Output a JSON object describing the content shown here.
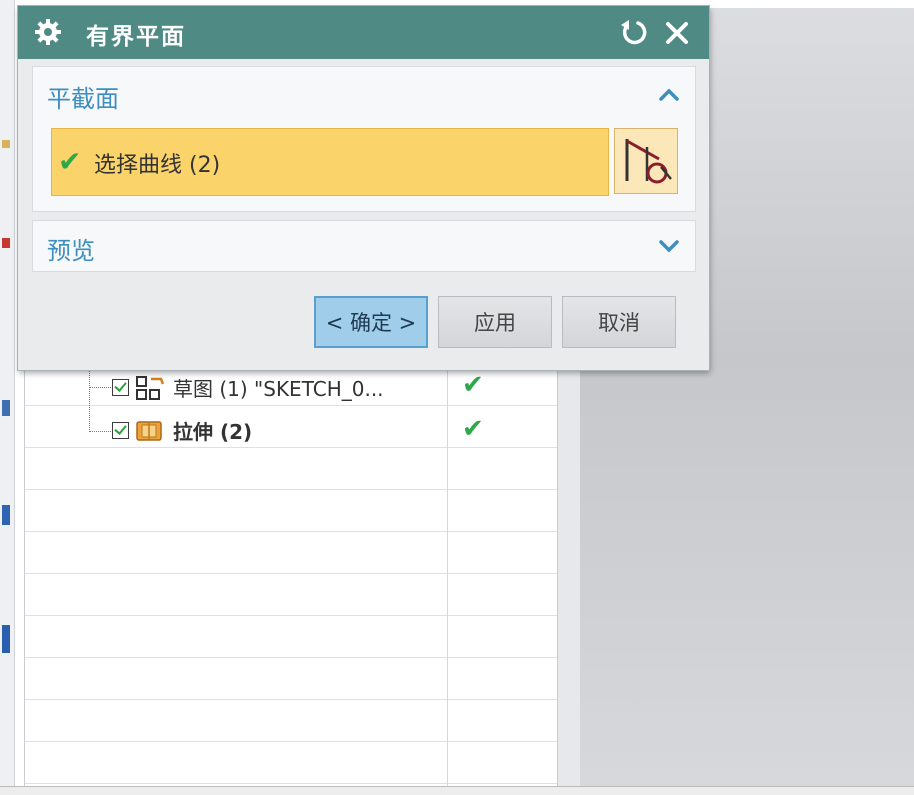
{
  "dialog": {
    "title": "有界平面",
    "sections": {
      "plane": {
        "title": "平截面",
        "expanded": true
      },
      "preview": {
        "title": "预览",
        "expanded": false
      }
    },
    "select_curve": {
      "label": "选择曲线 (2)",
      "status": "complete"
    },
    "buttons": {
      "ok": "< 确定 >",
      "apply": "应用",
      "cancel": "取消"
    }
  },
  "tree": {
    "items": [
      {
        "label": "草图 (1) \"SKETCH_0...",
        "checked": true,
        "status": "ok",
        "bold": false
      },
      {
        "label": "拉伸 (2)",
        "checked": true,
        "status": "ok",
        "bold": true
      }
    ]
  },
  "colors": {
    "title_bar": "#4f8a85",
    "section_title": "#3d8ec1",
    "selection_highlight": "#fbd36b",
    "ok_button": "#9fcdea",
    "check_green": "#2ea94a"
  }
}
